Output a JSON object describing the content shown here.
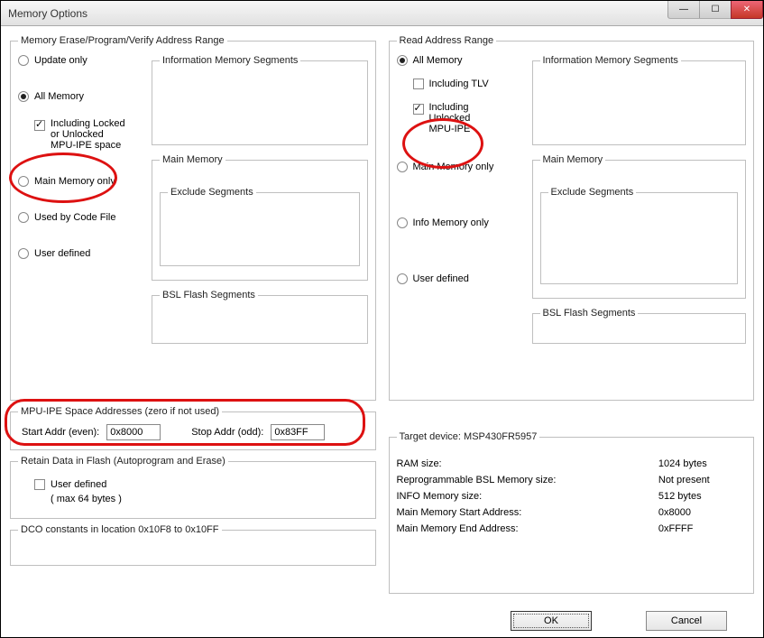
{
  "window": {
    "title": "Memory Options"
  },
  "left": {
    "group": "Memory Erase/Program/Verify Address Range",
    "radios": {
      "update": "Update only",
      "all": "All Memory",
      "main": "Main Memory only",
      "code": "Used by Code File",
      "user": "User defined"
    },
    "ipe_check": "Including Locked\nor Unlocked\nMPU-IPE space",
    "info_seg": "Information Memory Segments",
    "main_mem": "Main Memory",
    "exclude": "Exclude Segments",
    "bsl": "BSL Flash Segments",
    "mpu_group": "MPU-IPE Space Addresses (zero if not used)",
    "start_label": "Start Addr (even):",
    "start_value": "0x8000",
    "stop_label": "Stop Addr (odd):",
    "stop_value": "0x83FF",
    "retain_group": "Retain Data in Flash (Autoprogram and Erase)",
    "retain_user": "User defined",
    "retain_hint": "( max 64 bytes )",
    "dco_group": "DCO constants in location 0x10F8 to 0x10FF"
  },
  "right": {
    "group": "Read Address Range",
    "radios": {
      "all": "All Memory",
      "main": "Main Memory only",
      "info": "Info Memory only",
      "user": "User defined"
    },
    "tlv_check": "Including TLV",
    "ipe_check": "Including\nUnlocked\nMPU-IPE",
    "info_seg": "Information Memory Segments",
    "main_mem": "Main Memory",
    "exclude": "Exclude Segments",
    "bsl": "BSL Flash Segments"
  },
  "target": {
    "group": "Target device:  MSP430FR5957",
    "rows": {
      "ram_label": "RAM size:",
      "ram_value": "1024  bytes",
      "bsl_label": "Reprogrammable BSL Memory size:",
      "bsl_value": "Not present",
      "info_label": "INFO Memory size:",
      "info_value": "512  bytes",
      "mstart_label": "Main Memory Start Address:",
      "mstart_value": "0x8000",
      "mend_label": "Main Memory End Address:",
      "mend_value": "0xFFFF"
    }
  },
  "buttons": {
    "ok": "OK",
    "cancel": "Cancel"
  }
}
